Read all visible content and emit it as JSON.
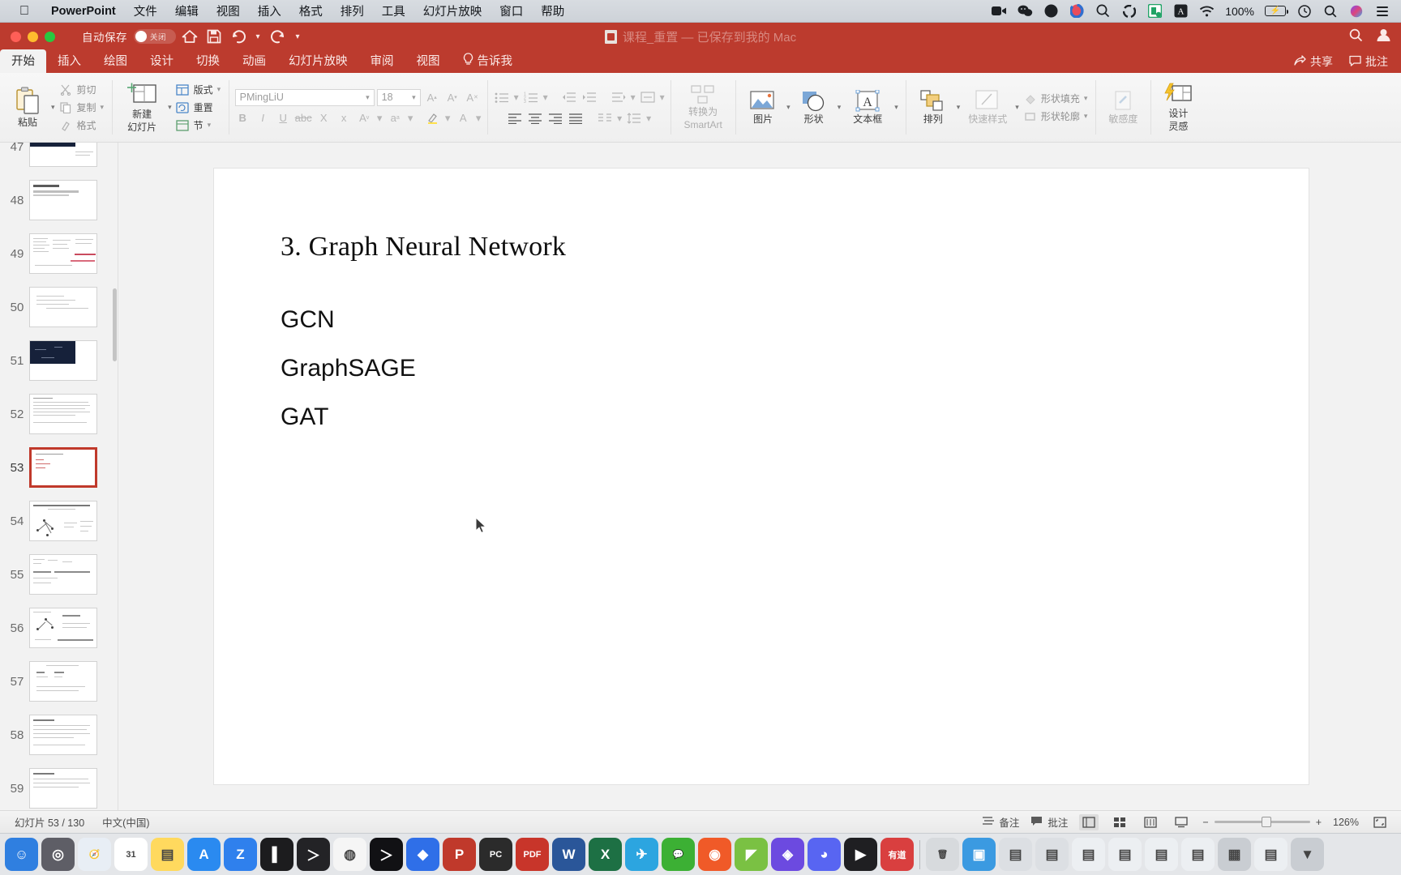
{
  "macmenu": {
    "apple_icon": "apple-icon",
    "app_name": "PowerPoint",
    "items": [
      "文件",
      "编辑",
      "视图",
      "插入",
      "格式",
      "排列",
      "工具",
      "幻灯片放映",
      "窗口",
      "帮助"
    ],
    "tray_icons": [
      "camera-icon",
      "wechat-icon",
      "location-icon",
      "sync-icon",
      "spotlight-search-icon",
      "bluetooth-icon",
      "green-app-icon",
      "input-source-icon",
      "wifi-icon"
    ],
    "battery_percent": "100%",
    "battery_icon": "battery-charging-icon",
    "clock_icon": "clock-icon",
    "search_icon": "search-icon",
    "siri_icon": "siri-icon",
    "control_center_icon": "control-center-icon"
  },
  "titlebar": {
    "autosave_label": "自动保存",
    "autosave_state": "关闭",
    "home_icon": "home-icon",
    "save_icon": "save-icon",
    "undo_icon": "undo-icon",
    "redo_icon": "redo-icon",
    "more_icon": "chevron-down-icon",
    "doc_title": "课程_重置 — 已保存到我的 Mac",
    "doc_title_visible": "课程_重置 — 已保存到我的 Mac",
    "search_icon": "search-icon",
    "account_icon": "account-icon",
    "accent_color": "#bc3b2e"
  },
  "ribbon_tabs": {
    "tabs": [
      "开始",
      "插入",
      "绘图",
      "设计",
      "切换",
      "动画",
      "幻灯片放映",
      "审阅",
      "视图"
    ],
    "active_tab": "开始",
    "tellme": "告诉我",
    "tellme_icon": "lightbulb-icon",
    "share_label": "共享",
    "share_icon": "share-icon",
    "comments_label": "批注",
    "comments_icon": "comment-icon"
  },
  "ribbon": {
    "clipboard": {
      "paste_label": "粘贴",
      "paste_icon": "paste-icon",
      "cut_label": "剪切",
      "cut_icon": "scissors-icon",
      "copy_label": "复制",
      "copy_icon": "copy-icon",
      "format_label": "格式",
      "format_icon": "format-painter-icon"
    },
    "slides": {
      "new_slide_label": "新建\n幻灯片",
      "new_slide_line1": "新建",
      "new_slide_line2": "幻灯片",
      "new_slide_icon": "new-slide-icon",
      "layout_label": "版式",
      "layout_icon": "layout-icon",
      "reset_label": "重置",
      "reset_icon": "reset-icon",
      "section_label": "节",
      "section_icon": "section-icon"
    },
    "font": {
      "font_name": "PMingLiU",
      "font_size": "18",
      "grow_icon": "grow-font-icon",
      "shrink_icon": "shrink-font-icon",
      "clear_format_icon": "clear-format-icon",
      "bold_icon": "bold-icon",
      "italic_icon": "italic-icon",
      "underline_icon": "underline-icon",
      "strikethrough_icon": "strikethrough-icon",
      "shadow_icon": "text-shadow-icon",
      "subscript_icon": "subscript-icon",
      "superscript_icon": "superscript-icon",
      "char_spacing_icon": "character-spacing-icon",
      "highlight_icon": "highlight-icon",
      "font_color_icon": "font-color-icon"
    },
    "paragraph": {
      "bullets_icon": "bullets-icon",
      "numbering_icon": "numbering-icon",
      "decrease_indent_icon": "decrease-indent-icon",
      "increase_indent_icon": "increase-indent-icon",
      "text_direction_icon": "text-direction-icon",
      "align_text_icon": "align-text-icon",
      "convert_smartart_line1": "转换为",
      "convert_smartart_line2": "SmartArt",
      "convert_smartart_icon": "smartart-icon",
      "align_left_icon": "align-left-icon",
      "align_center_icon": "align-center-icon",
      "align_right_icon": "align-right-icon",
      "justify_icon": "justify-icon",
      "columns_icon": "columns-icon",
      "line_spacing_icon": "line-spacing-icon"
    },
    "insert": {
      "picture_label": "图片",
      "picture_icon": "picture-icon",
      "shape_label": "形状",
      "shape_icon": "shape-icon",
      "textbox_label": "文本框",
      "textbox_icon": "textbox-icon"
    },
    "drawing": {
      "arrange_label": "排列",
      "arrange_icon": "arrange-icon",
      "quick_styles_label": "快速样式",
      "quick_styles_icon": "quick-styles-icon",
      "shape_fill_label": "形状填充",
      "shape_fill_icon": "shape-fill-icon",
      "shape_outline_label": "形状轮廓",
      "shape_outline_icon": "shape-outline-icon"
    },
    "sensitivity": {
      "label": "敏感度",
      "icon": "sensitivity-icon"
    },
    "designer": {
      "line1": "设计",
      "line2": "灵感",
      "icon": "design-ideas-icon"
    }
  },
  "thumbnails": {
    "selected": 53,
    "items": [
      {
        "num": "47",
        "kind": "dark-header"
      },
      {
        "num": "48",
        "kind": "title-text"
      },
      {
        "num": "49",
        "kind": "dense-red"
      },
      {
        "num": "50",
        "kind": "lines"
      },
      {
        "num": "51",
        "kind": "dark-header"
      },
      {
        "num": "52",
        "kind": "paragraph"
      },
      {
        "num": "53",
        "kind": "current-gnn"
      },
      {
        "num": "54",
        "kind": "graph-diagram"
      },
      {
        "num": "55",
        "kind": "formula"
      },
      {
        "num": "56",
        "kind": "graph-text"
      },
      {
        "num": "57",
        "kind": "formula2"
      },
      {
        "num": "58",
        "kind": "paragraph"
      },
      {
        "num": "59",
        "kind": "paragraph"
      }
    ]
  },
  "slide": {
    "title": "3. Graph Neural Network",
    "bullets": [
      "GCN",
      "GraphSAGE",
      "GAT"
    ]
  },
  "statusbar": {
    "slide_counter": "幻灯片 53 / 130",
    "language": "中文(中国)",
    "notes_label": "备注",
    "notes_icon": "notes-icon",
    "comments_label": "批注",
    "comments_icon": "comment-icon",
    "view_normal_icon": "normal-view-icon",
    "view_sorter_icon": "slide-sorter-icon",
    "view_reading_icon": "reading-view-icon",
    "view_show_icon": "slideshow-icon",
    "zoom_out_icon": "zoom-out-icon",
    "zoom_in_icon": "zoom-in-icon",
    "zoom_level": "126%",
    "fit_icon": "fit-slide-icon"
  },
  "dock": {
    "items": [
      {
        "name": "finder",
        "color": "#2f7fe0",
        "glyph": "☺"
      },
      {
        "name": "launchpad",
        "color": "#5e5e66",
        "glyph": "◎"
      },
      {
        "name": "safari",
        "color": "#e8eef5",
        "glyph": "🧭"
      },
      {
        "name": "calendar",
        "color": "#ffffff",
        "glyph": "31"
      },
      {
        "name": "notes",
        "color": "#ffd95e",
        "glyph": "▤"
      },
      {
        "name": "app-store",
        "color": "#2a8af0",
        "glyph": "A"
      },
      {
        "name": "zoom",
        "color": "#2f80ed",
        "glyph": "Z"
      },
      {
        "name": "terminal-dark",
        "color": "#1c1c1e",
        "glyph": "▌"
      },
      {
        "name": "terminal",
        "color": "#232326",
        "glyph": "＞"
      },
      {
        "name": "chrome",
        "color": "#f5f5f5",
        "glyph": "◍"
      },
      {
        "name": "iterm",
        "color": "#111114",
        "glyph": "＞"
      },
      {
        "name": "dropbox",
        "color": "#2f6fe8",
        "glyph": "◆"
      },
      {
        "name": "powerpoint",
        "color": "#c0392b",
        "glyph": "P"
      },
      {
        "name": "pycharm",
        "color": "#2b2b2b",
        "glyph": "PC"
      },
      {
        "name": "pdf-reader",
        "color": "#c8352a",
        "glyph": "PDF"
      },
      {
        "name": "word",
        "color": "#2a5699",
        "glyph": "W"
      },
      {
        "name": "excel",
        "color": "#1d7044",
        "glyph": "X"
      },
      {
        "name": "telegram",
        "color": "#2ca5e0",
        "glyph": "✈"
      },
      {
        "name": "wechat",
        "color": "#3cb034",
        "glyph": "💬"
      },
      {
        "name": "music-app",
        "color": "#f05a28",
        "glyph": "◉"
      },
      {
        "name": "evernote",
        "color": "#7ac143",
        "glyph": "◤"
      },
      {
        "name": "obsidian",
        "color": "#6c4ae0",
        "glyph": "◈"
      },
      {
        "name": "discord",
        "color": "#5865f2",
        "glyph": "◕"
      },
      {
        "name": "facetime",
        "color": "#1f1f22",
        "glyph": "▶"
      },
      {
        "name": "youdao",
        "color": "#d93f3f",
        "glyph": "有道"
      },
      {
        "name": "trash",
        "color": "#d7dadd",
        "glyph": "🗑"
      },
      {
        "name": "folder-blue",
        "color": "#3b9ae1",
        "glyph": "▣"
      },
      {
        "name": "folder-gray1",
        "color": "#dcdfe3",
        "glyph": "▤"
      },
      {
        "name": "folder-gray2",
        "color": "#dcdfe3",
        "glyph": "▤"
      },
      {
        "name": "folder-doc1",
        "color": "#eceff2",
        "glyph": "▤"
      },
      {
        "name": "folder-doc2",
        "color": "#eceff2",
        "glyph": "▤"
      },
      {
        "name": "folder-doc3",
        "color": "#eceff2",
        "glyph": "▤"
      },
      {
        "name": "folder-doc4",
        "color": "#eceff2",
        "glyph": "▤"
      },
      {
        "name": "folder-grid",
        "color": "#c9cdd2",
        "glyph": "▦"
      },
      {
        "name": "folder-doc5",
        "color": "#eceff2",
        "glyph": "▤"
      },
      {
        "name": "downloads",
        "color": "#c9cdd2",
        "glyph": "▼"
      }
    ]
  }
}
